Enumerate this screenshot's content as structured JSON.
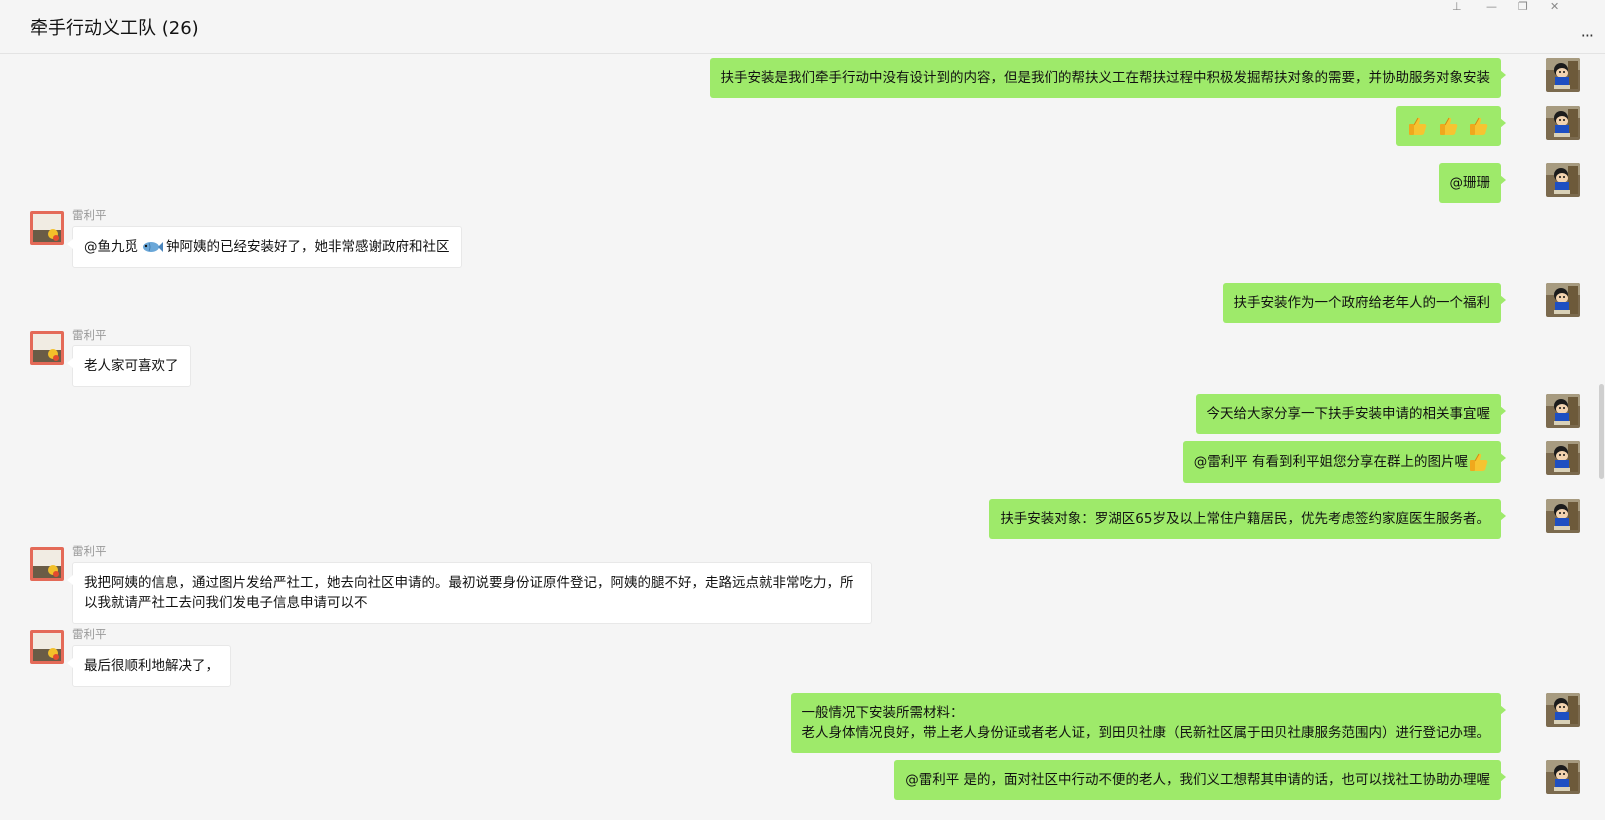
{
  "window": {
    "title": "牵手行动义工队 (26)",
    "pin": "⊥",
    "minimize": "—",
    "restore": "❐",
    "close": "✕",
    "more": "···"
  },
  "sender_name": "雷利平",
  "messages": {
    "m1": "扶手安装是我们牵手行动中没有设计到的内容，但是我们的帮扶义工在帮扶过程中积极发掘帮扶对象的需要，并协助服务对象安装",
    "m3": "@珊珊",
    "m4a": "@鱼九觅",
    "m4b": "钟阿姨的已经安装好了，她非常感谢政府和社区",
    "m5": "扶手安装作为一个政府给老年人的一个福利",
    "m6": "老人家可喜欢了",
    "m7": "今天给大家分享一下扶手安装申请的相关事宜喔",
    "m8": "@雷利平 有看到利平姐您分享在群上的图片喔",
    "m9": "扶手安装对象：罗湖区65岁及以上常住户籍居民，优先考虑签约家庭医生服务者。",
    "m10_line1": "我把阿姨的信息，通过图片发给严社工，她去向社区申请的。最初说要身份证原件登记，阿姨的腿不好，走路远点就非常吃力，所",
    "m10_line2": "以我就请严社工去问我们发电子信息申请可以不",
    "m11": "最后很顺利地解决了，",
    "m12_line1": "一般情况下安装所需材料：",
    "m12_line2": "老人身体情况良好，带上老人身份证或者老人证，到田贝社康（民新社区属于田贝社康服务范围内）进行登记办理。",
    "m13": "@雷利平 是的，面对社区中行动不便的老人，我们义工想帮其申请的话，也可以找社工协助办理喔"
  },
  "colors": {
    "sent_bubble": "#9eea6a",
    "recv_bubble": "#ffffff",
    "background": "#f5f5f5"
  },
  "icons": [
    "thumbs-up-icon",
    "fish-icon",
    "pin-icon",
    "minimize-icon",
    "restore-icon",
    "close-icon",
    "more-icon"
  ]
}
